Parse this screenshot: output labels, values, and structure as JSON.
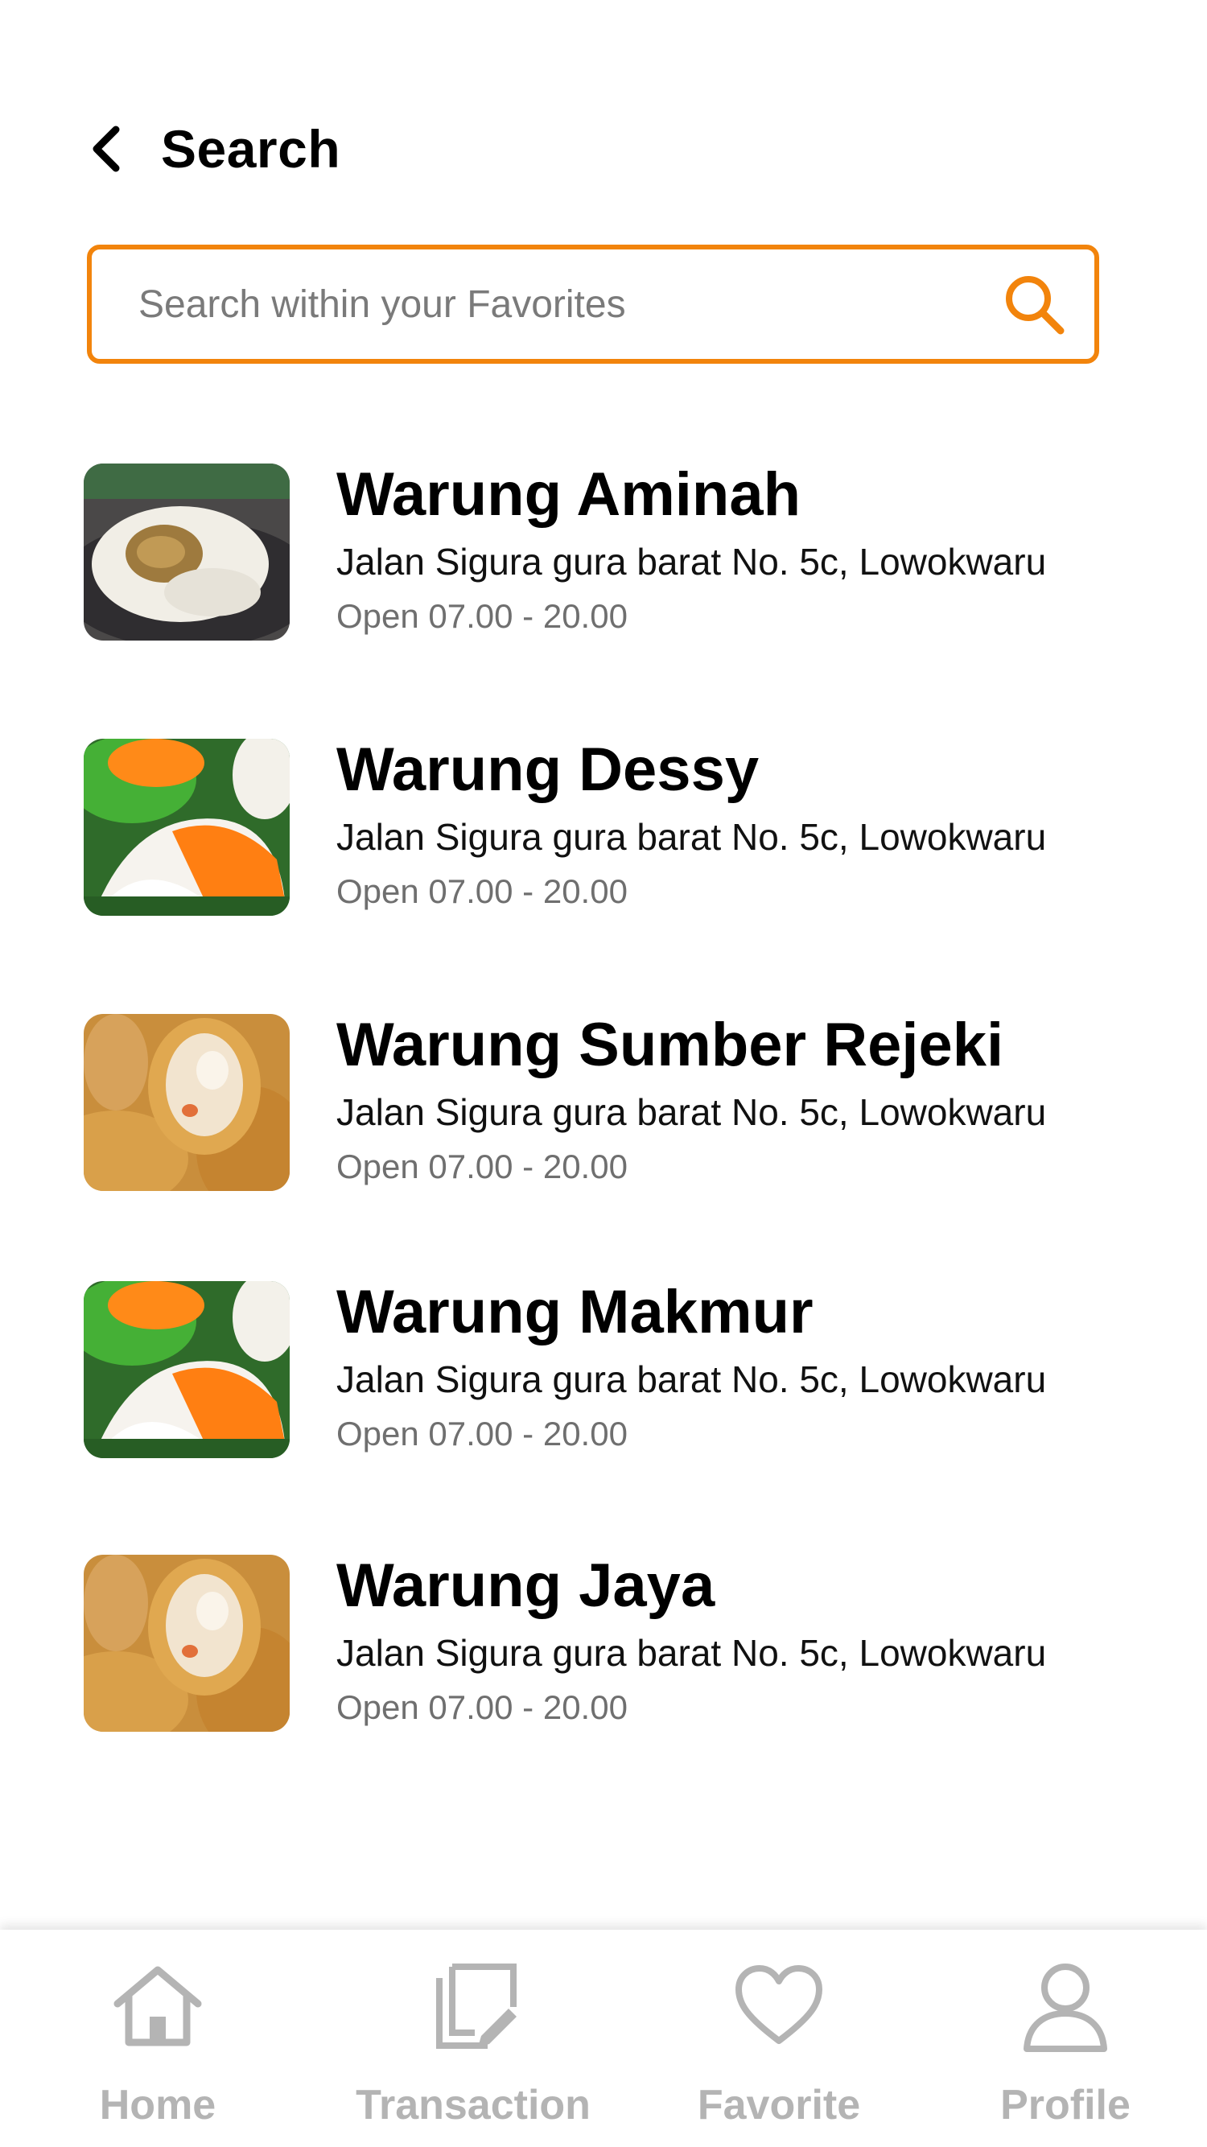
{
  "header": {
    "title": "Search"
  },
  "search": {
    "placeholder": "Search within your Favorites",
    "value": ""
  },
  "colors": {
    "accent": "#F2840C",
    "nav_inactive": "#b4b4b4",
    "muted_text": "#6f6f6f"
  },
  "results": [
    {
      "name": "Warung Aminah",
      "address": "Jalan Sigura gura barat No. 5c, Lowokwaru",
      "hours": "Open 07.00 - 20.00",
      "image": "dumpling-photo"
    },
    {
      "name": "Warung Dessy",
      "address": "Jalan Sigura gura barat No. 5c, Lowokwaru",
      "hours": "Open 07.00 - 20.00",
      "image": "layered-cake-photo"
    },
    {
      "name": "Warung Sumber Rejeki",
      "address": "Jalan Sigura gura barat No. 5c, Lowokwaru",
      "hours": "Open 07.00 - 20.00",
      "image": "fried-roll-photo"
    },
    {
      "name": "Warung Makmur",
      "address": "Jalan Sigura gura barat No. 5c, Lowokwaru",
      "hours": "Open 07.00 - 20.00",
      "image": "layered-cake-photo"
    },
    {
      "name": "Warung Jaya",
      "address": "Jalan Sigura gura barat No. 5c, Lowokwaru",
      "hours": "Open 07.00 - 20.00",
      "image": "fried-roll-photo"
    }
  ],
  "nav": [
    {
      "label": "Home",
      "icon": "home-icon"
    },
    {
      "label": "Transaction",
      "icon": "transaction-icon"
    },
    {
      "label": "Favorite",
      "icon": "heart-icon"
    },
    {
      "label": "Profile",
      "icon": "user-icon"
    }
  ]
}
